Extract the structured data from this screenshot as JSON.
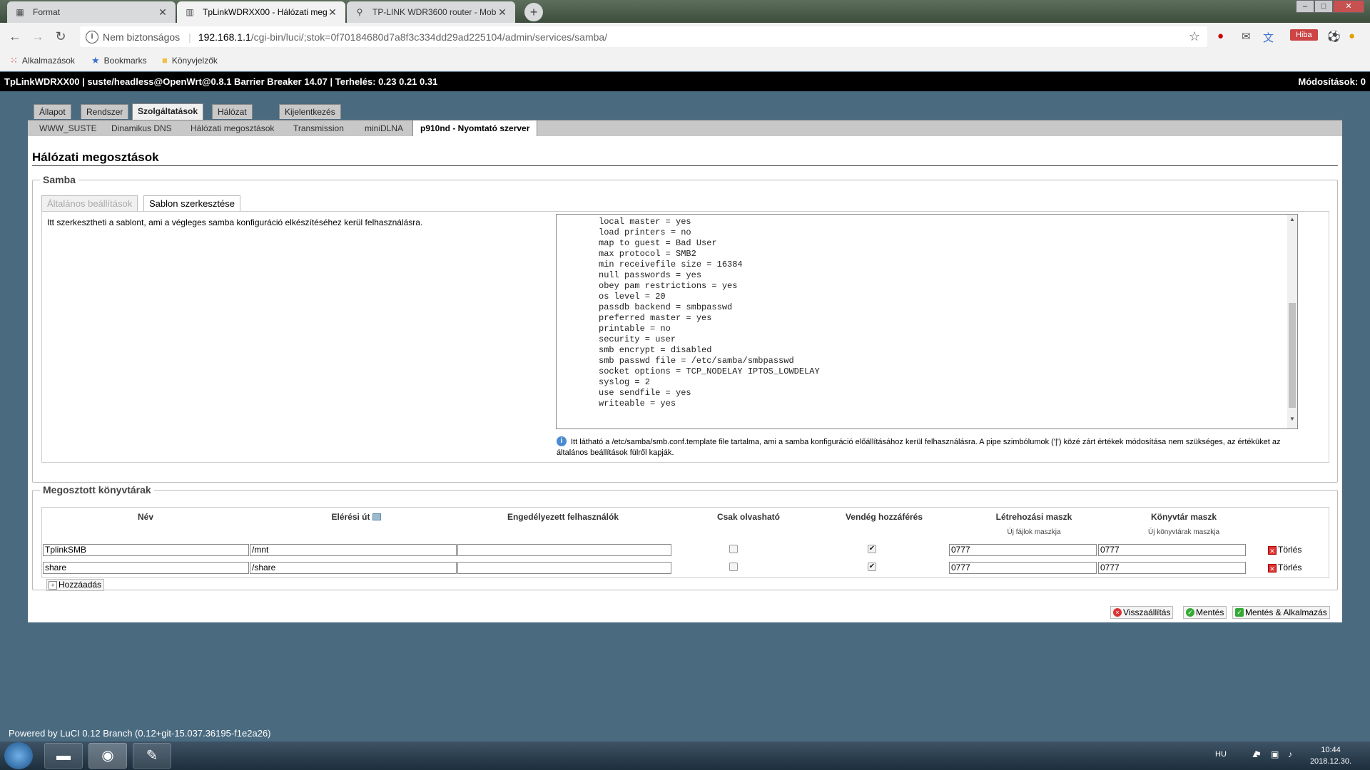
{
  "browser": {
    "tabs": [
      {
        "title": "Format",
        "favicon": "qr-icon",
        "active": false
      },
      {
        "title": "TpLinkWDRXX00 - Hálózati meg",
        "favicon": "luci-icon",
        "active": true
      },
      {
        "title": "TP-LINK WDR3600 router - Mob",
        "favicon": "link-icon",
        "active": false
      }
    ],
    "omnibox": {
      "security_label": "Nem biztonságos",
      "host": "192.168.1.1",
      "path": "/cgi-bin/luci/;stok=0f70184680d7a8f3c334dd29ad225104/admin/services/samba/"
    },
    "error_badge": "Hiba",
    "bookmarks": [
      "Alkalmazások",
      "Bookmarks",
      "Könyvjelzők"
    ]
  },
  "status": {
    "left": "TpLinkWDRXX00 | suste/headless@OpenWrt@0.8.1 Barrier Breaker 14.07 | Terhelés: 0.23 0.21 0.31",
    "changes": "Módosítások: 0"
  },
  "main_tabs": [
    "Állapot",
    "Rendszer",
    "Szolgáltatások",
    "Hálózat",
    "Kijelentkezés"
  ],
  "sub_tabs": [
    "WWW_SUSTE",
    "Dinamikus DNS",
    "Hálózati megosztások",
    "Transmission",
    "miniDLNA",
    "p910nd - Nyomtató szerver"
  ],
  "page_title": "Hálózati megosztások",
  "samba": {
    "legend": "Samba",
    "tabs": [
      "Általános beállítások",
      "Sablon szerkesztése"
    ],
    "description": "Itt szerkesztheti a sablont, ami a végleges samba konfiguráció elkészítéséhez kerül felhasználásra.",
    "template_lines": [
      "local master = yes",
      "load printers = no",
      "map to guest = Bad User",
      "max protocol = SMB2",
      "min receivefile size = 16384",
      "null passwords = yes",
      "obey pam restrictions = yes",
      "os level = 20",
      "passdb backend = smbpasswd",
      "preferred master = yes",
      "printable = no",
      "security = user",
      "smb encrypt = disabled",
      "smb passwd file = /etc/samba/smbpasswd",
      "socket options = TCP_NODELAY IPTOS_LOWDELAY",
      "syslog = 2",
      "use sendfile = yes",
      "writeable = yes"
    ],
    "hint": "Itt látható a /etc/samba/smb.conf.template file tartalma, ami a samba konfiguráció előállításához kerül felhasználásra. A pipe szimbólumok ('|') közé zárt értékek módosítása nem szükséges, az értéküket az általános beállítások fülről kapják."
  },
  "shares": {
    "legend": "Megosztott könyvtárak",
    "headers": {
      "name": "Név",
      "path": "Elérési út",
      "users": "Engedélyezett felhasználók",
      "readonly": "Csak olvasható",
      "guest": "Vendég hozzáférés",
      "create_mask": "Létrehozási maszk",
      "dir_mask": "Könyvtár maszk",
      "create_mask_sub": "Új fájlok maszkja",
      "dir_mask_sub": "Új könyvtárak maszkja"
    },
    "rows": [
      {
        "name": "TplinkSMB",
        "path": "/mnt",
        "users": "",
        "readonly": false,
        "guest": true,
        "create_mask": "0777",
        "dir_mask": "0777"
      },
      {
        "name": "share",
        "path": "/share",
        "users": "",
        "readonly": false,
        "guest": true,
        "create_mask": "0777",
        "dir_mask": "0777"
      }
    ],
    "delete_label": "Törlés",
    "add_label": "Hozzáadás"
  },
  "actions": {
    "reset": "Visszaállítás",
    "save": "Mentés",
    "save_apply": "Mentés & Alkalmazás"
  },
  "footer": "Powered by LuCI 0.12 Branch (0.12+git-15.037.36195-f1e2a26)",
  "taskbar": {
    "lang": "HU",
    "time": "10:44",
    "date": "2018.12.30."
  }
}
